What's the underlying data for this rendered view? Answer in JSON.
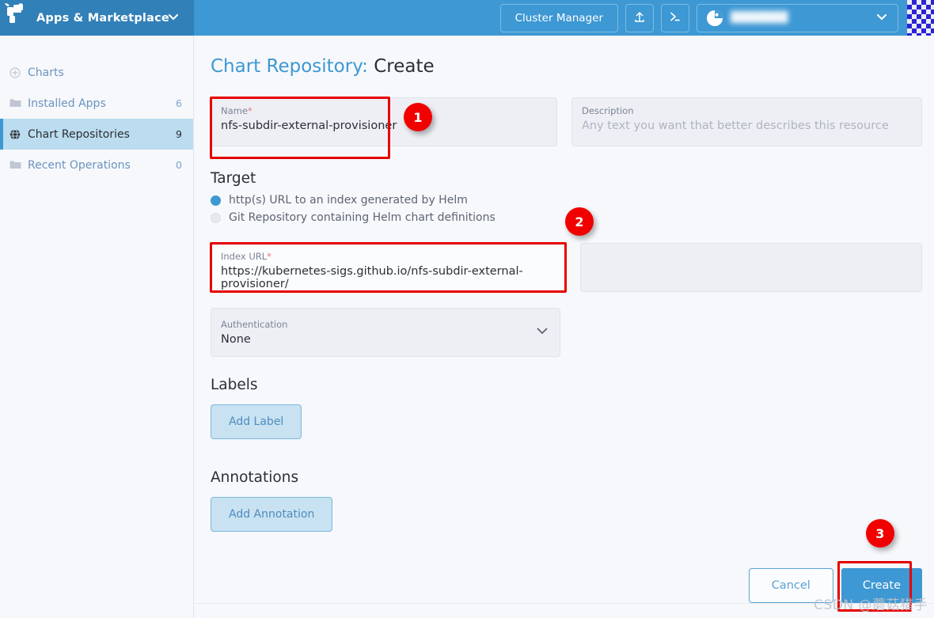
{
  "topbar": {
    "logo_icon": "rancher-logo-icon",
    "brand_title": "Apps & Marketplace",
    "brand_chevron_icon": "chevron-down-icon",
    "cluster_manager_label": "Cluster Manager",
    "import_icon": "upload-icon",
    "shell_icon": "terminal-icon",
    "user_avatar_icon": "user-avatar-icon",
    "user_name": "███████",
    "user_chevron_icon": "chevron-down-icon",
    "checker_icon": "checkerboard-icon",
    "accent_color": "#3d98d3"
  },
  "sidebar": {
    "items": [
      {
        "label": "Charts",
        "count": "",
        "icon": "plus-circle-icon",
        "active": false
      },
      {
        "label": "Installed Apps",
        "count": "6",
        "icon": "folder-icon",
        "active": false
      },
      {
        "label": "Chart Repositories",
        "count": "9",
        "icon": "globe-icon",
        "active": true
      },
      {
        "label": "Recent Operations",
        "count": "0",
        "icon": "folder-icon",
        "active": false
      }
    ]
  },
  "main": {
    "title_prefix": "Chart Repository:",
    "title_action": "Create",
    "name_field": {
      "label": "Name",
      "required": "*",
      "value": "nfs-subdir-external-provisioner"
    },
    "description_field": {
      "label": "Description",
      "placeholder": "Any text you want that better describes this resource",
      "value": ""
    },
    "target_section": {
      "heading": "Target",
      "options": [
        {
          "label": "http(s) URL to an index generated by Helm",
          "selected": true
        },
        {
          "label": "Git Repository containing Helm chart definitions",
          "selected": false
        }
      ]
    },
    "index_url_field": {
      "label": "Index URL",
      "required": "*",
      "value": "https://kubernetes-sigs.github.io/nfs-subdir-external-provisioner/"
    },
    "auth_field": {
      "label": "Authentication",
      "value": "None",
      "chevron_icon": "chevron-down-icon"
    },
    "labels_section": {
      "heading": "Labels",
      "add_button": "Add Label"
    },
    "annotations_section": {
      "heading": "Annotations",
      "add_button": "Add Annotation"
    },
    "footer": {
      "cancel_label": "Cancel",
      "create_label": "Create"
    }
  },
  "markers": {
    "one": "1",
    "two": "2",
    "three": "3",
    "color": "#f20000"
  },
  "watermark": {
    "text": "CSDN @蘑菇猎手"
  }
}
